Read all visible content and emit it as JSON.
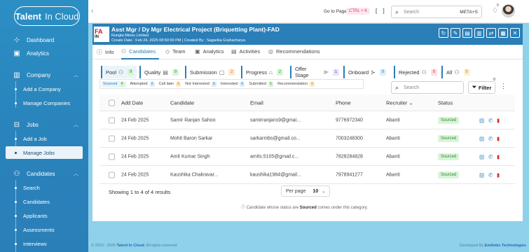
{
  "brand": {
    "name_bold": "Talent",
    "name_light": "In Cloud"
  },
  "sidebar": {
    "items": [
      {
        "label": "Dashboard",
        "icon": "dashboard-icon"
      },
      {
        "label": "Analytics",
        "icon": "analytics-icon"
      },
      {
        "label": "Company",
        "icon": "company-icon"
      },
      {
        "label": "Add a Company"
      },
      {
        "label": "Manage Companies"
      },
      {
        "label": "Jobs",
        "icon": "briefcase-icon"
      },
      {
        "label": "Add a Job"
      },
      {
        "label": "Manage Jobs",
        "active": true
      },
      {
        "label": "Candidates",
        "icon": "users-icon"
      },
      {
        "label": "Search"
      },
      {
        "label": "Candidates"
      },
      {
        "label": "Applicants"
      },
      {
        "label": "Assessments"
      },
      {
        "label": "Interviews"
      }
    ]
  },
  "topbar": {
    "goto_label": "Go to Page",
    "shortcut": "CTRL + K",
    "brackets": "[ ]",
    "search_placeholder": "Search",
    "search_shortcut": "META+S",
    "notification_count": "0"
  },
  "job": {
    "logo_top": "FA",
    "logo_bottom": "IN",
    "title": "Asst Mgr / Dy Mgr Electrical Project (Briquetting Plant)-FAD",
    "company": "Rungta Mines Limited",
    "meta": "Create Date : Feb 24, 2025 08:50:00 PM | Created By : Sagarika Grahacharya"
  },
  "tabs": [
    "Info",
    "Candidates",
    "Team",
    "Analytics",
    "Activities",
    "Recommendations"
  ],
  "stages": [
    {
      "label": "Pool",
      "count": "9",
      "color": "green"
    },
    {
      "label": "Quality",
      "count": "0",
      "color": "green"
    },
    {
      "label": "Submission",
      "count": "2",
      "color": "orange"
    },
    {
      "label": "Progress",
      "count": "2",
      "color": "green"
    },
    {
      "label": "Offer Stage",
      "count": "1",
      "color": "purple"
    },
    {
      "label": "Onboard",
      "count": "0",
      "color": "blue"
    },
    {
      "label": "Rejected",
      "count": "0",
      "color": "red"
    },
    {
      "label": "All",
      "count": "5",
      "color": "yellow"
    }
  ],
  "subfilters": [
    {
      "label": "Sourced",
      "count": "4"
    },
    {
      "label": "Attempted",
      "count": "0"
    },
    {
      "label": "Call later",
      "count": "5"
    },
    {
      "label": "Not Interested",
      "count": "0"
    },
    {
      "label": "Interested",
      "count": "0"
    },
    {
      "label": "Submitted",
      "count": "5"
    },
    {
      "label": "Recommendation",
      "count": "0"
    }
  ],
  "candidate_search_placeholder": "Search",
  "filter_label": "Filter",
  "filter_count": "0",
  "table": {
    "headers": [
      "Add Date",
      "Candidate",
      "Email",
      "Phone",
      "Recruiter",
      "Status"
    ],
    "rows": [
      {
        "date": "24 Feb 2025",
        "name": "Samir Ranjan Sahoo",
        "email": "samirranjans9@gmai...",
        "phone": "9776972340",
        "recruiter": "Abanti",
        "status": "Sourced"
      },
      {
        "date": "24 Feb 2025",
        "name": "Mohit Baron Sarkar",
        "email": "sarkarmbs@gmail.co...",
        "phone": "7003248300",
        "recruiter": "Abanti",
        "status": "Sourced"
      },
      {
        "date": "24 Feb 2025",
        "name": "Amit Kumar Singh",
        "email": "amits.5105@gmail.c...",
        "phone": "7828284828",
        "recruiter": "Abanti",
        "status": "Sourced"
      },
      {
        "date": "24 Feb 2025",
        "name": "Kaushika Chakravar...",
        "email": "kaushika1984@gmail...",
        "phone": "7978941277",
        "recruiter": "Abanti",
        "status": "Sourced"
      }
    ]
  },
  "pagination": {
    "showing": "Showing 1 to 4 of 4 results",
    "per_page_label": "Per page",
    "per_page_value": "10"
  },
  "note": {
    "prefix": "Candidate whose status are",
    "bold": "Sourced",
    "suffix": "comes under this category."
  },
  "footer": {
    "left_prefix": "© 2023 - 2025",
    "left_brand": "Talent In Cloud",
    "left_suffix": ". All rights reserved",
    "right_prefix": "Developed By",
    "right_brand": "Emilinks Technologies"
  }
}
